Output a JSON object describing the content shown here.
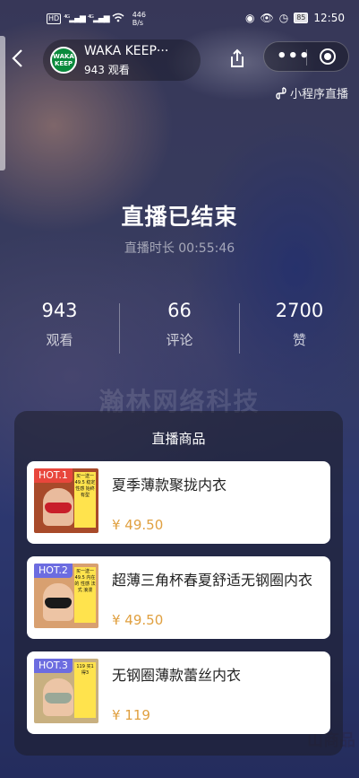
{
  "status_bar": {
    "left": [
      "HD",
      "⁴ᴳ",
      "⁴ᴳ"
    ],
    "speed_value": "446",
    "speed_unit": "B/s",
    "battery": "85",
    "time": "12:50"
  },
  "header": {
    "logo_text": "WAKA KEEP",
    "store_name": "WAKA KEEP···",
    "viewers": "943 观看"
  },
  "mini_program_tag": "小程序直播",
  "watermark": "瀚林网络科技",
  "corner_mark": "山商品",
  "live": {
    "ended_title": "直播已结束",
    "duration": "直播时长 00:55:46"
  },
  "stats": [
    {
      "value": "943",
      "label": "观看"
    },
    {
      "value": "66",
      "label": "评论"
    },
    {
      "value": "2700",
      "label": "赞"
    }
  ],
  "products": {
    "title": "直播商品",
    "items": [
      {
        "hot": "HOT.1",
        "name": "夏季薄款聚拢内衣",
        "price": "¥ 49.50",
        "hot_color": "#e8463c",
        "bra_color": "#c81e2a",
        "thumb_bg": "#a84a2a",
        "tag": "买一送一 49.5 稳定 性感 始终 有型"
      },
      {
        "hot": "HOT.2",
        "name": "超薄三角杯春夏舒适无钢圈内衣",
        "price": "¥ 49.50",
        "hot_color": "#6c6ce0",
        "bra_color": "#1a1a1a",
        "thumb_bg": "#d8a070",
        "tag": "买一送一 49.5 内在的 性感 法式 浪漫"
      },
      {
        "hot": "HOT.3",
        "name": "无钢圈薄款蕾丝内衣",
        "price": "¥ 119",
        "hot_color": "#6c6ce0",
        "bra_color": "#9aa898",
        "thumb_bg": "#c8b080",
        "tag": "119 买1 得3"
      }
    ]
  }
}
